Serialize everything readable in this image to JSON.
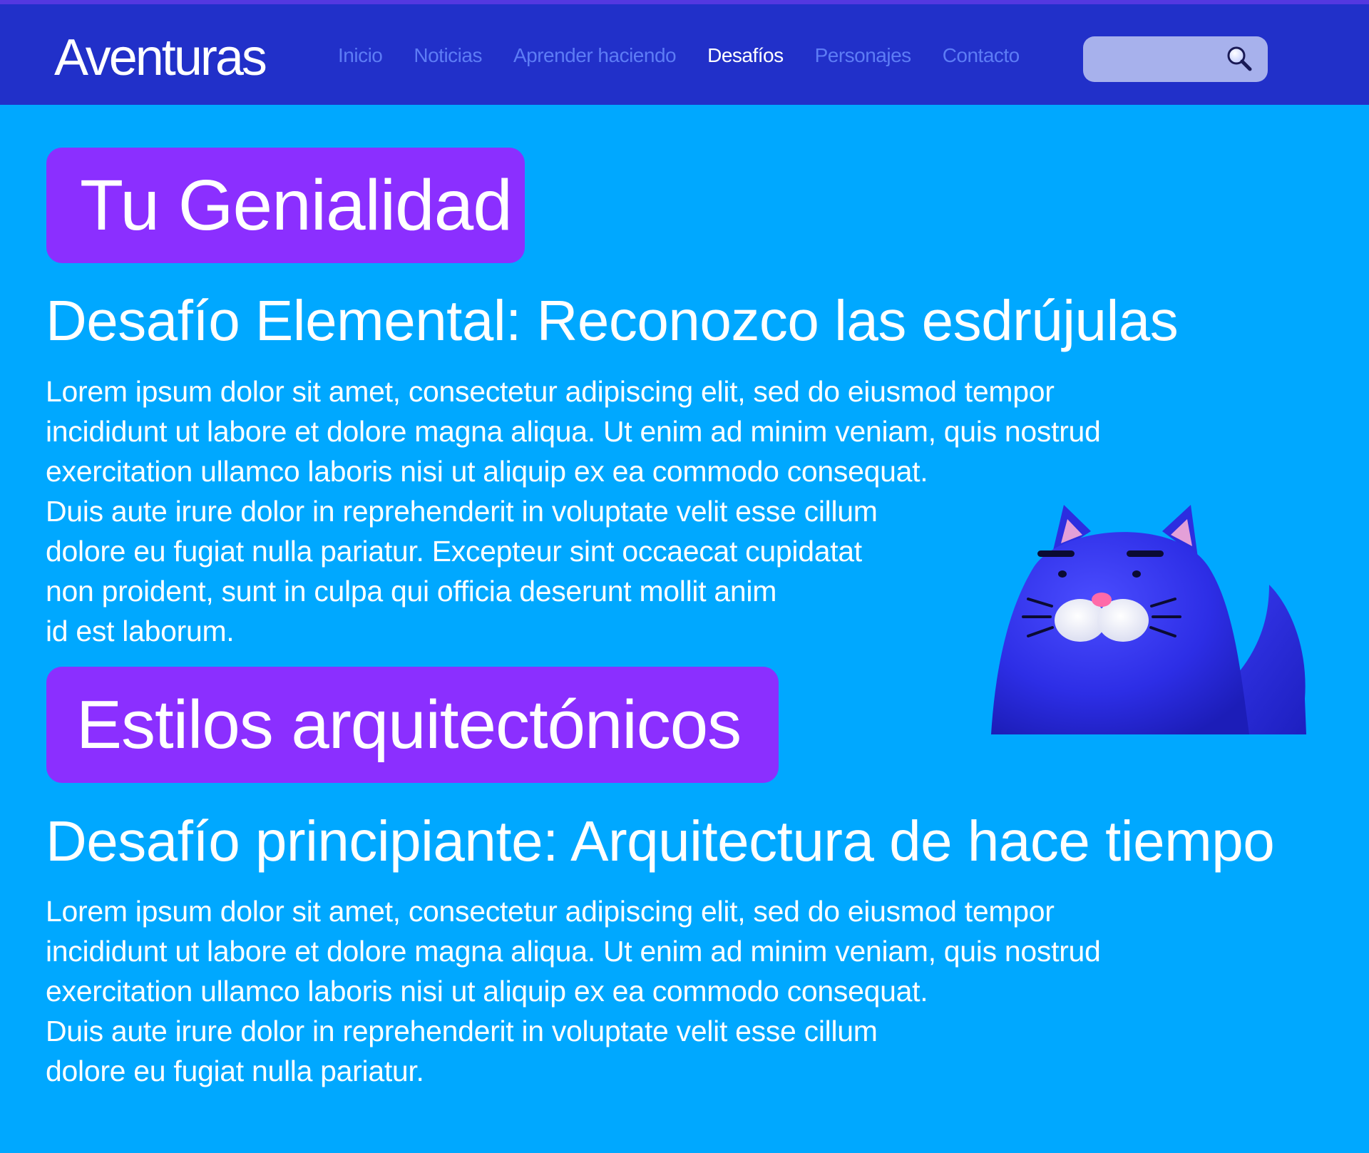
{
  "header": {
    "logo": "Aventuras",
    "nav": [
      {
        "label": "Inicio",
        "active": false
      },
      {
        "label": "Noticias",
        "active": false
      },
      {
        "label": "Aprender haciendo",
        "active": false
      },
      {
        "label": "Desafíos",
        "active": true
      },
      {
        "label": "Personajes",
        "active": false
      },
      {
        "label": "Contacto",
        "active": false
      }
    ],
    "search": {
      "placeholder": "",
      "icon": "search-icon"
    }
  },
  "sections": [
    {
      "badge": "Tu Genialidad",
      "title": "Desafío Elemental: Reconozco las esdrújulas",
      "body_lines": [
        "Lorem ipsum dolor sit amet, consectetur adipiscing elit, sed do eiusmod tempor",
        "incididunt ut labore et dolore magna aliqua. Ut enim ad minim veniam, quis nostrud",
        "exercitation ullamco laboris nisi ut aliquip ex ea commodo consequat.",
        "Duis aute irure dolor in reprehenderit in voluptate velit esse cillum",
        "dolore eu fugiat nulla pariatur. Excepteur sint occaecat cupidatat",
        "non proident, sunt in culpa qui officia deserunt mollit anim",
        "id est laborum."
      ]
    },
    {
      "badge": "Estilos arquitectónicos",
      "title": "Desafío principiante: Arquitectura de hace tiempo",
      "body_lines": [
        "Lorem ipsum dolor sit amet, consectetur adipiscing elit, sed do eiusmod tempor",
        "incididunt ut labore et dolore magna aliqua. Ut enim ad minim veniam, quis nostrud",
        "exercitation ullamco laboris nisi ut aliquip ex ea commodo consequat.",
        "Duis aute irure dolor in reprehenderit in voluptate velit esse cillum",
        "dolore eu fugiat nulla pariatur."
      ]
    }
  ],
  "mascot": {
    "icon": "blue-cat-mascot-icon"
  },
  "colors": {
    "page_background": "#00a8ff",
    "header_background": "#2130c9",
    "badge_background": "#8b2fff",
    "nav_inactive": "#5d7cf5",
    "nav_active": "#ffffff",
    "search_background": "#a7b1ec"
  }
}
